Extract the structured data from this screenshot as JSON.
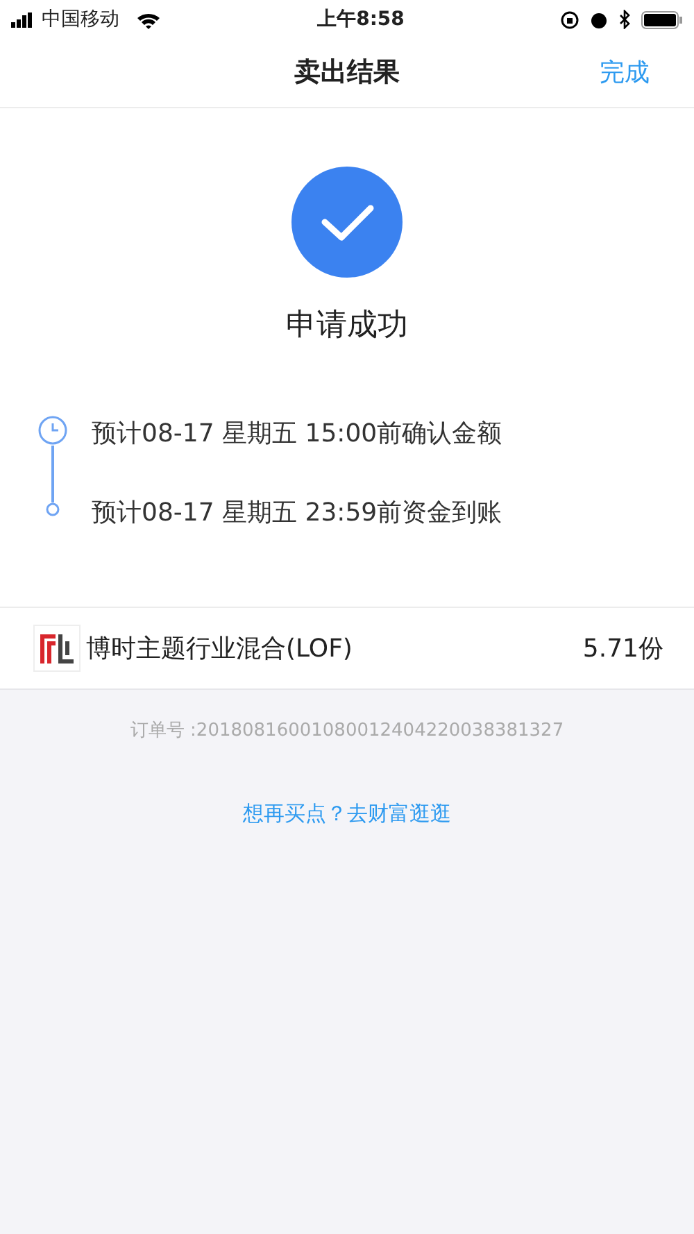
{
  "status_bar": {
    "carrier": "中国移动",
    "time": "上午8:58"
  },
  "nav": {
    "title": "卖出结果",
    "action": "完成"
  },
  "result": {
    "message": "申请成功"
  },
  "timeline": [
    {
      "kind": "clock",
      "text": "预计08-17 星期五 15:00前确认金额"
    },
    {
      "kind": "dot",
      "text": "预计08-17 星期五 23:59前资金到账"
    }
  ],
  "fund": {
    "name": "博时主题行业混合(LOF)",
    "shares": "5.71份"
  },
  "order_no": "订单号 :20180816001080012404220038381327",
  "link": "想再买点？去财富逛逛"
}
